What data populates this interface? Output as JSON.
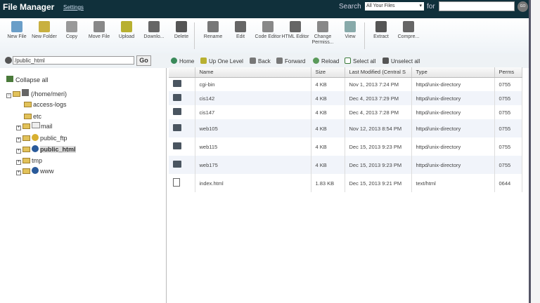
{
  "header": {
    "title": "File Manager",
    "settings": "Settings",
    "search_label": "Search",
    "search_scope": "All Your Files",
    "for_label": "for",
    "go": "GO"
  },
  "toolbar": [
    {
      "label": "New File",
      "icon": "new-file-icon",
      "color": "#6a9ec8"
    },
    {
      "label": "New Folder",
      "icon": "new-folder-icon",
      "color": "#c8b040"
    },
    {
      "label": "Copy",
      "icon": "copy-icon",
      "color": "#999"
    },
    {
      "label": "Move File",
      "icon": "move-file-icon",
      "color": "#888"
    },
    {
      "label": "Upload",
      "icon": "upload-icon",
      "color": "#b8b030"
    },
    {
      "label": "Downlo...",
      "icon": "download-icon",
      "color": "#666"
    },
    {
      "label": "Delete",
      "icon": "delete-icon",
      "color": "#555"
    },
    {
      "label": "Rename",
      "icon": "rename-icon",
      "color": "#777"
    },
    {
      "label": "Edit",
      "icon": "edit-icon",
      "color": "#666"
    },
    {
      "label": "Code Editor",
      "icon": "code-editor-icon",
      "color": "#888"
    },
    {
      "label": "HTML Editor",
      "icon": "html-editor-icon",
      "color": "#666"
    },
    {
      "label": "Change Permiss...",
      "icon": "permissions-icon",
      "color": "#888"
    },
    {
      "label": "View",
      "icon": "view-icon",
      "color": "#8aa"
    },
    {
      "label": "Extract",
      "icon": "extract-icon",
      "color": "#555"
    },
    {
      "label": "Compre...",
      "icon": "compress-icon",
      "color": "#666"
    }
  ],
  "path": {
    "value": "/public_html",
    "go": "Go"
  },
  "nav": [
    "Home",
    "Up One Level",
    "Back",
    "Forward",
    "Reload",
    "Select all",
    "Unselect all"
  ],
  "tree": {
    "collapse": "Collapse all",
    "root": "(/home/meri)",
    "items": [
      "access-logs",
      "etc",
      "mail",
      "public_ftp",
      "public_html",
      "tmp",
      "www"
    ]
  },
  "table": {
    "headers": [
      "Name",
      "Size",
      "Last Modified (Central S",
      "Type",
      "Perms"
    ],
    "rows": [
      {
        "name": "cgi-bin",
        "size": "4 KB",
        "modified": "Nov 1, 2013 7:24 PM",
        "type": "httpd/unix-directory",
        "perms": "0755"
      },
      {
        "name": "cis142",
        "size": "4 KB",
        "modified": "Dec 4, 2013 7:29 PM",
        "type": "httpd/unix-directory",
        "perms": "0755"
      },
      {
        "name": "cis147",
        "size": "4 KB",
        "modified": "Dec 4, 2013 7:28 PM",
        "type": "httpd/unix-directory",
        "perms": "0755"
      },
      {
        "name": "web105",
        "size": "4 KB",
        "modified": "Nov 12, 2013 8:54 PM",
        "type": "httpd/unix-directory",
        "perms": "0755"
      },
      {
        "name": "web115",
        "size": "4 KB",
        "modified": "Dec 15, 2013 9:23 PM",
        "type": "httpd/unix-directory",
        "perms": "0755"
      },
      {
        "name": "web175",
        "size": "4 KB",
        "modified": "Dec 15, 2013 9:23 PM",
        "type": "httpd/unix-directory",
        "perms": "0755"
      },
      {
        "name": "index.html",
        "size": "1.83 KB",
        "modified": "Dec 15, 2013 9:21 PM",
        "type": "text/html",
        "perms": "0644"
      }
    ]
  }
}
